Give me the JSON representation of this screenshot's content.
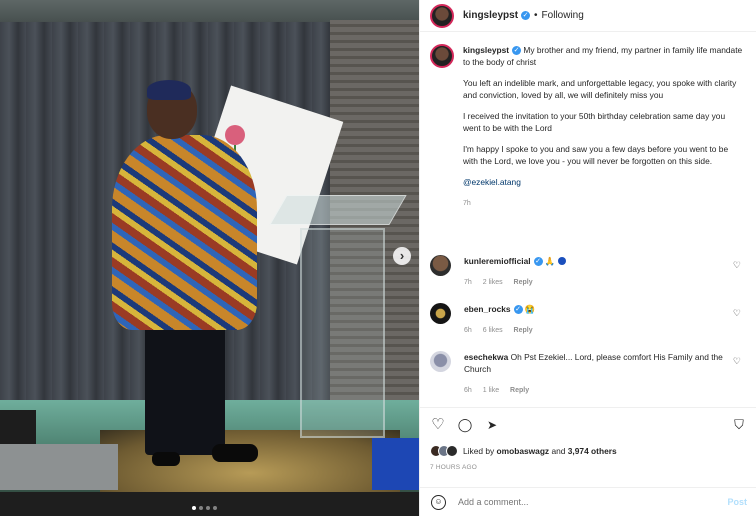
{
  "post": {
    "username": "kingsleypst",
    "follow_state": "Following",
    "separator": "•",
    "verified_mark": "✓",
    "caption_p1": "My brother and my friend, my partner in family life mandate to the body of christ",
    "caption_p2": "You left an indelible mark, and unforgettable legacy, you spoke with clarity and conviction, loved by all, we will definitely miss you",
    "caption_p3": "I received the invitation to your 50th birthday celebration same day you went to be with the Lord",
    "caption_p4": "I'm happy I spoke to you and saw you a few days before you went to be with the Lord, we love you - you will never be forgotten on this side.",
    "mention": "@ezekiel.atang",
    "time": "7h"
  },
  "media": {
    "next_glyph": "›",
    "carousel_count": 4,
    "carousel_active": 1
  },
  "comments": [
    {
      "username": "kunleremiofficial",
      "text": "🙏",
      "time": "7h",
      "likes": "2 likes",
      "reply": "Reply",
      "verified": true
    },
    {
      "username": "eben_rocks",
      "text": "😭",
      "time": "6h",
      "likes": "6 likes",
      "reply": "Reply",
      "verified": true
    },
    {
      "username": "esechekwa",
      "text": "Oh Pst Ezekiel... Lord, please comfort His Family and the Church",
      "time": "6h",
      "likes": "1 like",
      "reply": "Reply",
      "verified": false
    }
  ],
  "actions": {
    "like_icon": "♡",
    "comment_icon": "◯",
    "share_icon": "➤",
    "save_icon": "⛉"
  },
  "likes": {
    "prefix": "Liked by",
    "user": "omobaswagz",
    "middle": "and",
    "others": "3,974 others"
  },
  "timestamp": "7 HOURS AGO",
  "add_comment": {
    "placeholder": "Add a comment...",
    "post_label": "Post",
    "emoji_icon": "☺"
  },
  "colors": {
    "verified_blue": "#3897f0",
    "story_ring": "#d3285a",
    "post_button": "#b2dffc"
  }
}
